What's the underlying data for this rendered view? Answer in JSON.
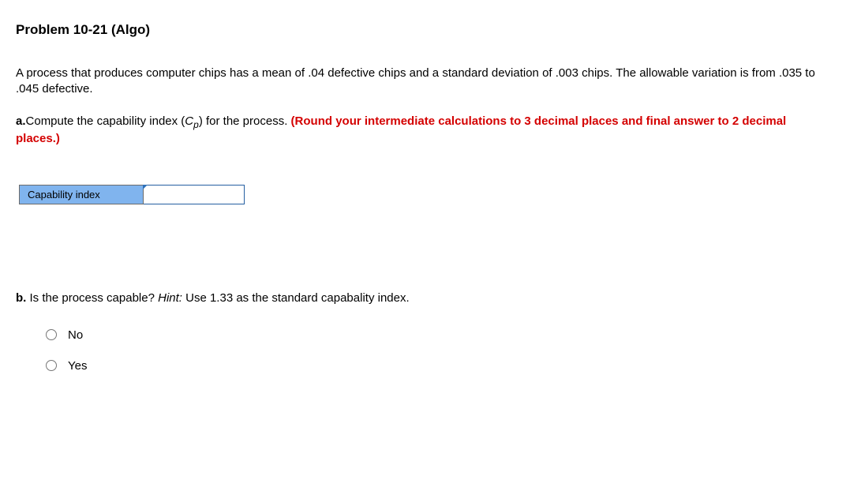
{
  "title": "Problem 10-21 (Algo)",
  "description": "A process that produces computer chips has a mean of .04 defective chips and a standard deviation of .003 chips. The allowable variation is from .035 to .045 defective.",
  "partA": {
    "prefix": "a.",
    "text1": "Compute the capability index (",
    "var": "C",
    "sub": "p",
    "text2": ") for the process. ",
    "instruction": "(Round your intermediate calculations to 3 decimal places and final answer to 2 decimal places.)"
  },
  "answerLabel": "Capability index",
  "answerValue": "",
  "partB": {
    "prefix": "b.",
    "text": " Is the process capable? ",
    "hintLabel": "Hint:",
    "hintText": " Use 1.33 as the standard capabality index."
  },
  "options": [
    {
      "label": "No"
    },
    {
      "label": "Yes"
    }
  ]
}
